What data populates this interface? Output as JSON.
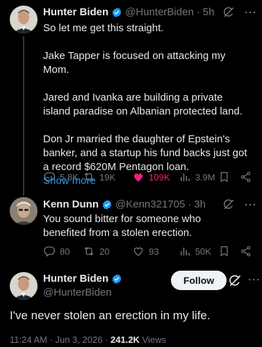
{
  "colors": {
    "background": "#000000",
    "text": "#e7e9ea",
    "muted": "#71767b",
    "link": "#1d9bf0",
    "like": "#f91880",
    "verified": "#1d9bf0"
  },
  "tweet1": {
    "display_name": "Hunter Biden",
    "handle": "@HunterBiden",
    "time": "5h",
    "paragraphs": [
      "So let me get this straight.",
      "Jake Tapper is focused on attacking my Mom.",
      "Jared and Ivanka are building a private island paradise on Albanian protected land.",
      "Don Jr married the daughter of Epstein's banker, and a startup his fund backs just got a record $620M Pentagon loan."
    ],
    "show_more": "Show more",
    "replies": "5.8K",
    "reposts": "19K",
    "likes": "109K",
    "views": "3.9M"
  },
  "tweet2": {
    "display_name": "Kenn Dunn",
    "handle": "@Kenn321705",
    "time": "3h",
    "text": "You sound bitter for someone who benefited from a stolen erection.",
    "replies": "80",
    "reposts": "20",
    "likes": "93",
    "views": "50K"
  },
  "tweet3": {
    "display_name": "Hunter Biden",
    "handle": "@HunterBiden",
    "follow_label": "Follow",
    "text": "I've never stolen an erection in my life.",
    "timestamp": "11:24 AM · Jun 3, 2026 · ",
    "views_count": "241.2K",
    "views_label": " Views"
  },
  "icons": {
    "reply": "reply-icon",
    "repost": "repost-icon",
    "like": "heart-icon",
    "views": "views-icon",
    "bookmark": "bookmark-icon",
    "share": "share-icon",
    "grok": "grok-icon",
    "more": "more-icon",
    "verified": "verified-badge-icon"
  }
}
